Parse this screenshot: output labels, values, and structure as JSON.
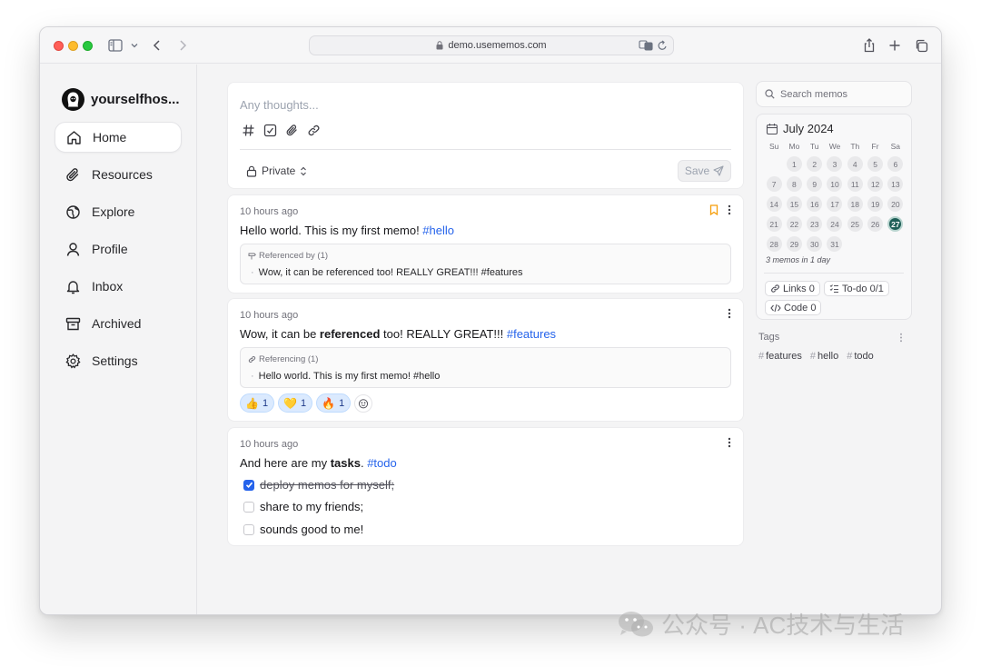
{
  "browser": {
    "url": "demo.usememos.com"
  },
  "sidebar": {
    "user_name": "yourselfhos...",
    "items": [
      {
        "label": "Home",
        "icon": "home-icon"
      },
      {
        "label": "Resources",
        "icon": "paperclip-icon"
      },
      {
        "label": "Explore",
        "icon": "globe-icon"
      },
      {
        "label": "Profile",
        "icon": "user-icon"
      },
      {
        "label": "Inbox",
        "icon": "bell-icon"
      },
      {
        "label": "Archived",
        "icon": "archive-icon"
      },
      {
        "label": "Settings",
        "icon": "gear-icon"
      }
    ]
  },
  "editor": {
    "placeholder": "Any thoughts...",
    "visibility": "Private",
    "save_label": "Save"
  },
  "memos": [
    {
      "time": "10 hours ago",
      "text_before": "Hello world. This is my first memo! ",
      "tag": "#hello",
      "ref_title": "Referenced by (1)",
      "ref_item": "Wow, it can be referenced too! REALLY GREAT!!! #features"
    },
    {
      "time": "10 hours ago",
      "text_before": "Wow, it can be ",
      "text_bold": "referenced",
      "text_after": " too! REALLY GREAT!!! ",
      "tag": "#features",
      "ref_title": "Referencing (1)",
      "ref_item": "Hello world. This is my first memo! #hello",
      "reactions": [
        {
          "emoji": "👍",
          "count": "1"
        },
        {
          "emoji": "💛",
          "count": "1"
        },
        {
          "emoji": "🔥",
          "count": "1"
        }
      ]
    },
    {
      "time": "10 hours ago",
      "text_before": "And here are my ",
      "text_bold": "tasks",
      "text_after": ". ",
      "tag": "#todo",
      "tasks": [
        {
          "text": "deploy memos for myself;",
          "done": true
        },
        {
          "text": "share to my friends;",
          "done": false
        },
        {
          "text": "sounds good to me!",
          "done": false
        }
      ]
    }
  ],
  "search": {
    "placeholder": "Search memos"
  },
  "calendar": {
    "title": "July 2024",
    "weekdays": [
      "Su",
      "Mo",
      "Tu",
      "We",
      "Th",
      "Fr",
      "Sa"
    ],
    "days": [
      "1",
      "2",
      "3",
      "4",
      "5",
      "6",
      "7",
      "8",
      "9",
      "10",
      "11",
      "12",
      "13",
      "14",
      "15",
      "16",
      "17",
      "18",
      "19",
      "20",
      "21",
      "22",
      "23",
      "24",
      "25",
      "26",
      "27",
      "28",
      "29",
      "30",
      "31"
    ],
    "today": "27",
    "summary": "3 memos in 1 day"
  },
  "stats": {
    "links": "Links 0",
    "todo": "To-do 0/1",
    "code": "Code 0"
  },
  "tags": {
    "title": "Tags",
    "items": [
      "features",
      "hello",
      "todo"
    ]
  },
  "watermark": "公众号 · AC技术与生活",
  "colors": {
    "accent": "#2563eb",
    "today": "#1f5f57",
    "bookmark": "#f59e0b"
  }
}
